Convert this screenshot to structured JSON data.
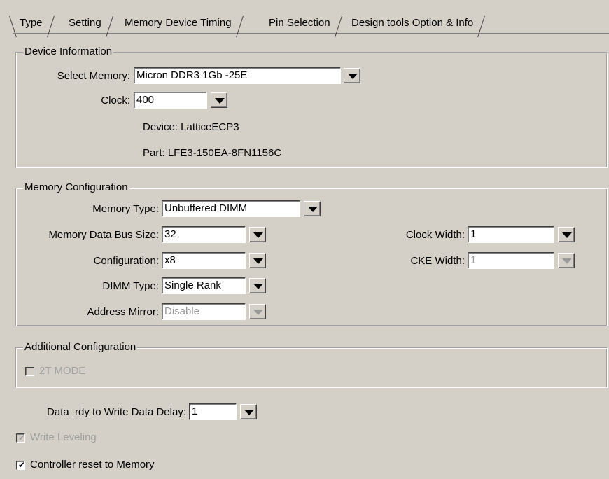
{
  "tabs": [
    {
      "label": "Type",
      "active": true
    },
    {
      "label": "Setting"
    },
    {
      "label": "Memory Device Timing"
    },
    {
      "label": "Pin Selection"
    },
    {
      "label": "Design tools Option & Info"
    }
  ],
  "device_information": {
    "legend": "Device Information",
    "select_memory": {
      "label": "Select Memory:",
      "value": "Micron DDR3 1Gb -25E"
    },
    "clock": {
      "label": "Clock:",
      "value": "400"
    },
    "device": "Device: LatticeECP3",
    "part": "Part: LFE3-150EA-8FN1156C"
  },
  "memory_configuration": {
    "legend": "Memory Configuration",
    "memory_type": {
      "label": "Memory Type:",
      "value": "Unbuffered DIMM"
    },
    "data_bus_size": {
      "label": "Memory Data Bus Size:",
      "value": "32"
    },
    "configuration": {
      "label": "Configuration:",
      "value": "x8"
    },
    "dimm_type": {
      "label": "DIMM Type:",
      "value": "Single Rank"
    },
    "address_mirror": {
      "label": "Address Mirror:",
      "value": "Disable"
    },
    "clock_width": {
      "label": "Clock Width:",
      "value": "1"
    },
    "cke_width": {
      "label": "CKE Width:",
      "value": "1"
    }
  },
  "additional_configuration": {
    "legend": "Additional Configuration",
    "two_t_mode": {
      "label": "2T MODE",
      "checked": false
    }
  },
  "data_rdy_delay": {
    "label": "Data_rdy to Write Data Delay:",
    "value": "1"
  },
  "write_leveling": {
    "label": "Write Leveling",
    "checked": true
  },
  "controller_reset": {
    "label": "Controller reset to Memory",
    "checked": true
  },
  "icons": {
    "dropdown": "chevron-down-icon",
    "check": "checkmark-icon"
  }
}
